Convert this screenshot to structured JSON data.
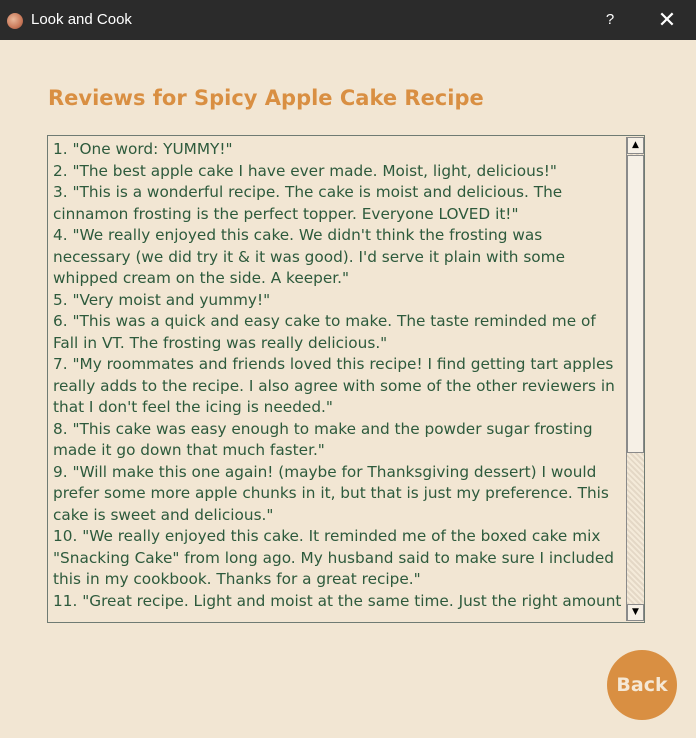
{
  "window": {
    "title": "Look and Cook",
    "help_label": "?",
    "close_label": "✕"
  },
  "heading": "Reviews for Spicy Apple Cake Recipe",
  "reviews": [
    "1. \"One word: YUMMY!\"",
    "2. \"The best apple cake I have ever made. Moist, light, delicious!\"",
    "3. \"This is a wonderful recipe.  The cake is moist and delicious.  The cinnamon frosting is the perfect topper.  Everyone LOVED it!\"",
    "4. \"We really enjoyed this cake. We didn't think the frosting was necessary (we did try it & it was good). I'd serve it plain with some whipped cream on the side. A keeper.\"",
    "5. \"Very moist and yummy!\"",
    "6. \"This was a quick and easy cake to make.  The taste reminded me of Fall in VT.  The frosting was really delicious.\"",
    "7. \"My roommates and friends loved this recipe! I find getting tart apples really adds to the recipe. I also agree with some of the other reviewers in that I don't feel the icing is needed.\"",
    "8. \"This cake was easy enough to make and the powder sugar frosting made it go down that much faster.\"",
    "9. \"Will make this one again! (maybe for Thanksgiving dessert) I would prefer some more apple chunks in it, but that is just my preference. This cake is sweet and delicious.\"",
    "10. \"We really enjoyed this cake.  It reminded me of the boxed cake mix \"Snacking Cake\" from long ago.  My husband said to make sure I included this in my cookbook.  Thanks for a great recipe.\"",
    "11. \"Great recipe. Light and moist at the same time. Just the right amount"
  ],
  "scroll": {
    "up_label": "▲",
    "down_label": "▼"
  },
  "back_label": "Back",
  "icons": {
    "app_icon": "cake-logo-icon",
    "help": "help-icon",
    "close": "close-icon",
    "scroll_up": "arrow-up-icon",
    "scroll_down": "arrow-down-icon"
  },
  "colors": {
    "title_bar": "#2b2b2b",
    "background": "#f2e6d3",
    "heading": "#d98f42",
    "text": "#2d5a3c",
    "accent_button": "#d98f42"
  }
}
